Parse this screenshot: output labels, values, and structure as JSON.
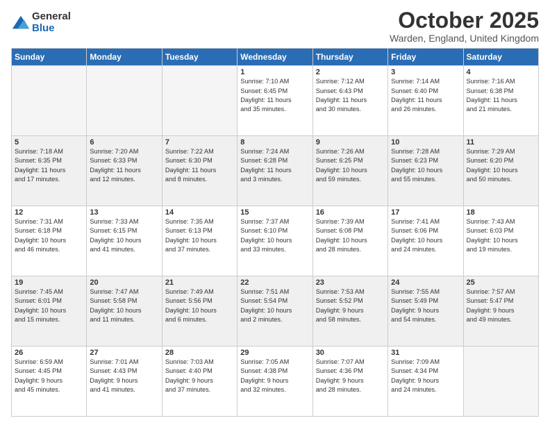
{
  "logo": {
    "general": "General",
    "blue": "Blue"
  },
  "title": "October 2025",
  "location": "Warden, England, United Kingdom",
  "days_of_week": [
    "Sunday",
    "Monday",
    "Tuesday",
    "Wednesday",
    "Thursday",
    "Friday",
    "Saturday"
  ],
  "weeks": [
    [
      {
        "day": "",
        "info": ""
      },
      {
        "day": "",
        "info": ""
      },
      {
        "day": "",
        "info": ""
      },
      {
        "day": "1",
        "info": "Sunrise: 7:10 AM\nSunset: 6:45 PM\nDaylight: 11 hours\nand 35 minutes."
      },
      {
        "day": "2",
        "info": "Sunrise: 7:12 AM\nSunset: 6:43 PM\nDaylight: 11 hours\nand 30 minutes."
      },
      {
        "day": "3",
        "info": "Sunrise: 7:14 AM\nSunset: 6:40 PM\nDaylight: 11 hours\nand 26 minutes."
      },
      {
        "day": "4",
        "info": "Sunrise: 7:16 AM\nSunset: 6:38 PM\nDaylight: 11 hours\nand 21 minutes."
      }
    ],
    [
      {
        "day": "5",
        "info": "Sunrise: 7:18 AM\nSunset: 6:35 PM\nDaylight: 11 hours\nand 17 minutes."
      },
      {
        "day": "6",
        "info": "Sunrise: 7:20 AM\nSunset: 6:33 PM\nDaylight: 11 hours\nand 12 minutes."
      },
      {
        "day": "7",
        "info": "Sunrise: 7:22 AM\nSunset: 6:30 PM\nDaylight: 11 hours\nand 8 minutes."
      },
      {
        "day": "8",
        "info": "Sunrise: 7:24 AM\nSunset: 6:28 PM\nDaylight: 11 hours\nand 3 minutes."
      },
      {
        "day": "9",
        "info": "Sunrise: 7:26 AM\nSunset: 6:25 PM\nDaylight: 10 hours\nand 59 minutes."
      },
      {
        "day": "10",
        "info": "Sunrise: 7:28 AM\nSunset: 6:23 PM\nDaylight: 10 hours\nand 55 minutes."
      },
      {
        "day": "11",
        "info": "Sunrise: 7:29 AM\nSunset: 6:20 PM\nDaylight: 10 hours\nand 50 minutes."
      }
    ],
    [
      {
        "day": "12",
        "info": "Sunrise: 7:31 AM\nSunset: 6:18 PM\nDaylight: 10 hours\nand 46 minutes."
      },
      {
        "day": "13",
        "info": "Sunrise: 7:33 AM\nSunset: 6:15 PM\nDaylight: 10 hours\nand 41 minutes."
      },
      {
        "day": "14",
        "info": "Sunrise: 7:35 AM\nSunset: 6:13 PM\nDaylight: 10 hours\nand 37 minutes."
      },
      {
        "day": "15",
        "info": "Sunrise: 7:37 AM\nSunset: 6:10 PM\nDaylight: 10 hours\nand 33 minutes."
      },
      {
        "day": "16",
        "info": "Sunrise: 7:39 AM\nSunset: 6:08 PM\nDaylight: 10 hours\nand 28 minutes."
      },
      {
        "day": "17",
        "info": "Sunrise: 7:41 AM\nSunset: 6:06 PM\nDaylight: 10 hours\nand 24 minutes."
      },
      {
        "day": "18",
        "info": "Sunrise: 7:43 AM\nSunset: 6:03 PM\nDaylight: 10 hours\nand 19 minutes."
      }
    ],
    [
      {
        "day": "19",
        "info": "Sunrise: 7:45 AM\nSunset: 6:01 PM\nDaylight: 10 hours\nand 15 minutes."
      },
      {
        "day": "20",
        "info": "Sunrise: 7:47 AM\nSunset: 5:58 PM\nDaylight: 10 hours\nand 11 minutes."
      },
      {
        "day": "21",
        "info": "Sunrise: 7:49 AM\nSunset: 5:56 PM\nDaylight: 10 hours\nand 6 minutes."
      },
      {
        "day": "22",
        "info": "Sunrise: 7:51 AM\nSunset: 5:54 PM\nDaylight: 10 hours\nand 2 minutes."
      },
      {
        "day": "23",
        "info": "Sunrise: 7:53 AM\nSunset: 5:52 PM\nDaylight: 9 hours\nand 58 minutes."
      },
      {
        "day": "24",
        "info": "Sunrise: 7:55 AM\nSunset: 5:49 PM\nDaylight: 9 hours\nand 54 minutes."
      },
      {
        "day": "25",
        "info": "Sunrise: 7:57 AM\nSunset: 5:47 PM\nDaylight: 9 hours\nand 49 minutes."
      }
    ],
    [
      {
        "day": "26",
        "info": "Sunrise: 6:59 AM\nSunset: 4:45 PM\nDaylight: 9 hours\nand 45 minutes."
      },
      {
        "day": "27",
        "info": "Sunrise: 7:01 AM\nSunset: 4:43 PM\nDaylight: 9 hours\nand 41 minutes."
      },
      {
        "day": "28",
        "info": "Sunrise: 7:03 AM\nSunset: 4:40 PM\nDaylight: 9 hours\nand 37 minutes."
      },
      {
        "day": "29",
        "info": "Sunrise: 7:05 AM\nSunset: 4:38 PM\nDaylight: 9 hours\nand 32 minutes."
      },
      {
        "day": "30",
        "info": "Sunrise: 7:07 AM\nSunset: 4:36 PM\nDaylight: 9 hours\nand 28 minutes."
      },
      {
        "day": "31",
        "info": "Sunrise: 7:09 AM\nSunset: 4:34 PM\nDaylight: 9 hours\nand 24 minutes."
      },
      {
        "day": "",
        "info": ""
      }
    ]
  ]
}
